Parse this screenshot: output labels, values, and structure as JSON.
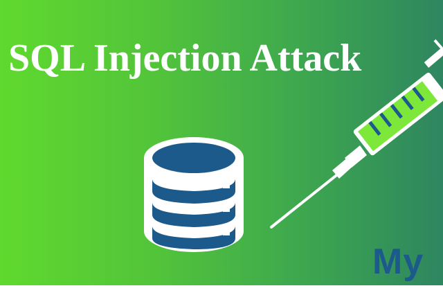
{
  "banner": {
    "title": "SQL Injection Attack",
    "brand_mark": "My"
  },
  "icons": {
    "database": "database-icon",
    "syringe": "syringe-icon"
  },
  "colors": {
    "gradient_start": "#5fd92e",
    "gradient_end": "#2e8660",
    "title_text": "#ffffff",
    "database_fill": "#1d5a8c",
    "syringe_liquid": "#7ee83a",
    "brand_mark": "#1d5a8c"
  }
}
